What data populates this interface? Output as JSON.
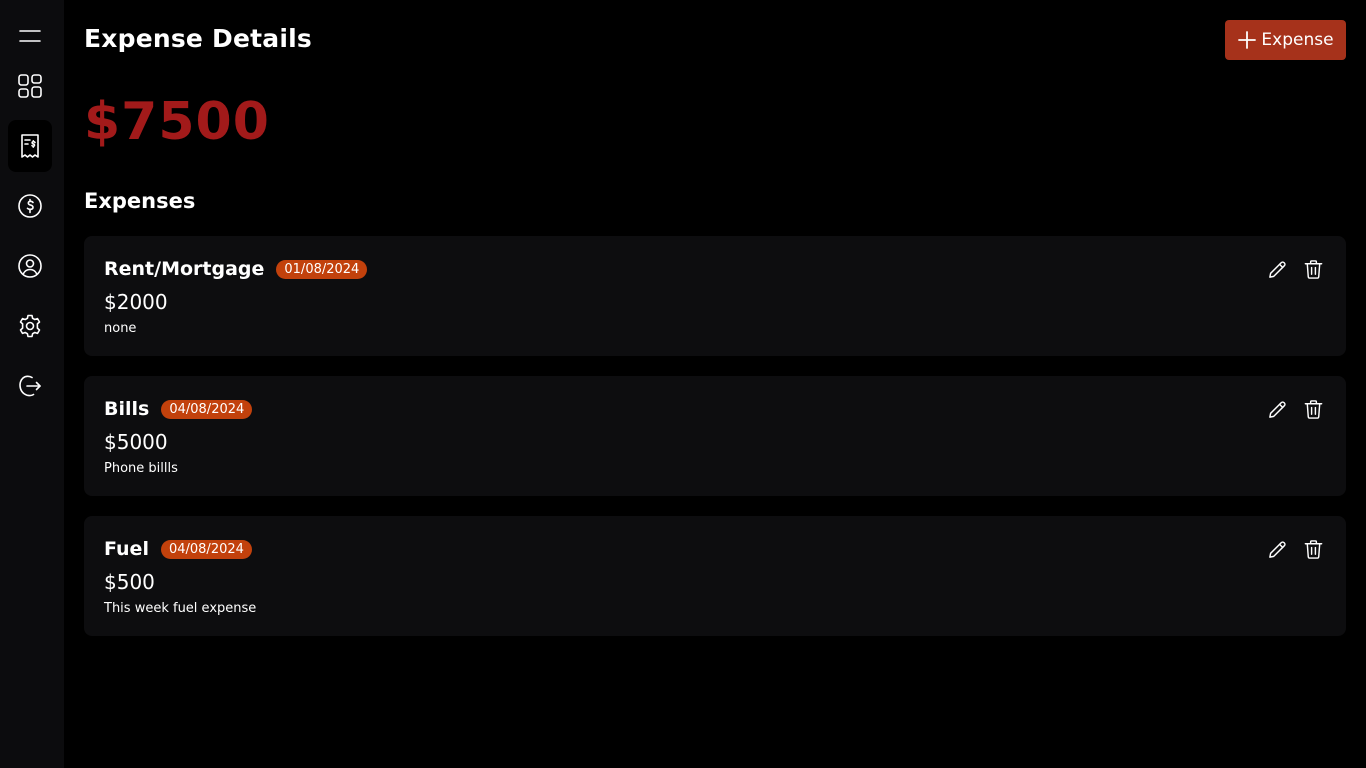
{
  "colors": {
    "accent_button": "#a6321b",
    "total_amount": "#a21a1a",
    "date_badge": "#c2410c",
    "card_bg": "#0d0d0f",
    "sidebar_bg": "#0c0c0e"
  },
  "sidebar": {
    "items": [
      {
        "icon": "menu-icon",
        "active": false
      },
      {
        "icon": "dashboard-grid-icon",
        "active": false
      },
      {
        "icon": "receipt-dollar-icon",
        "active": true
      },
      {
        "icon": "dollar-circle-icon",
        "active": false
      },
      {
        "icon": "user-circle-icon",
        "active": false
      },
      {
        "icon": "gear-icon",
        "active": false
      },
      {
        "icon": "logout-icon",
        "active": false
      }
    ]
  },
  "header": {
    "title": "Expense Details",
    "add_button_label": "Expense"
  },
  "total": "$7500",
  "section_title": "Expenses",
  "expenses": [
    {
      "name": "Rent/Mortgage",
      "date": "01/08/2024",
      "amount": "$2000",
      "description": "none"
    },
    {
      "name": "Bills",
      "date": "04/08/2024",
      "amount": "$5000",
      "description": "Phone billls"
    },
    {
      "name": "Fuel",
      "date": "04/08/2024",
      "amount": "$500",
      "description": "This week fuel expense"
    }
  ]
}
